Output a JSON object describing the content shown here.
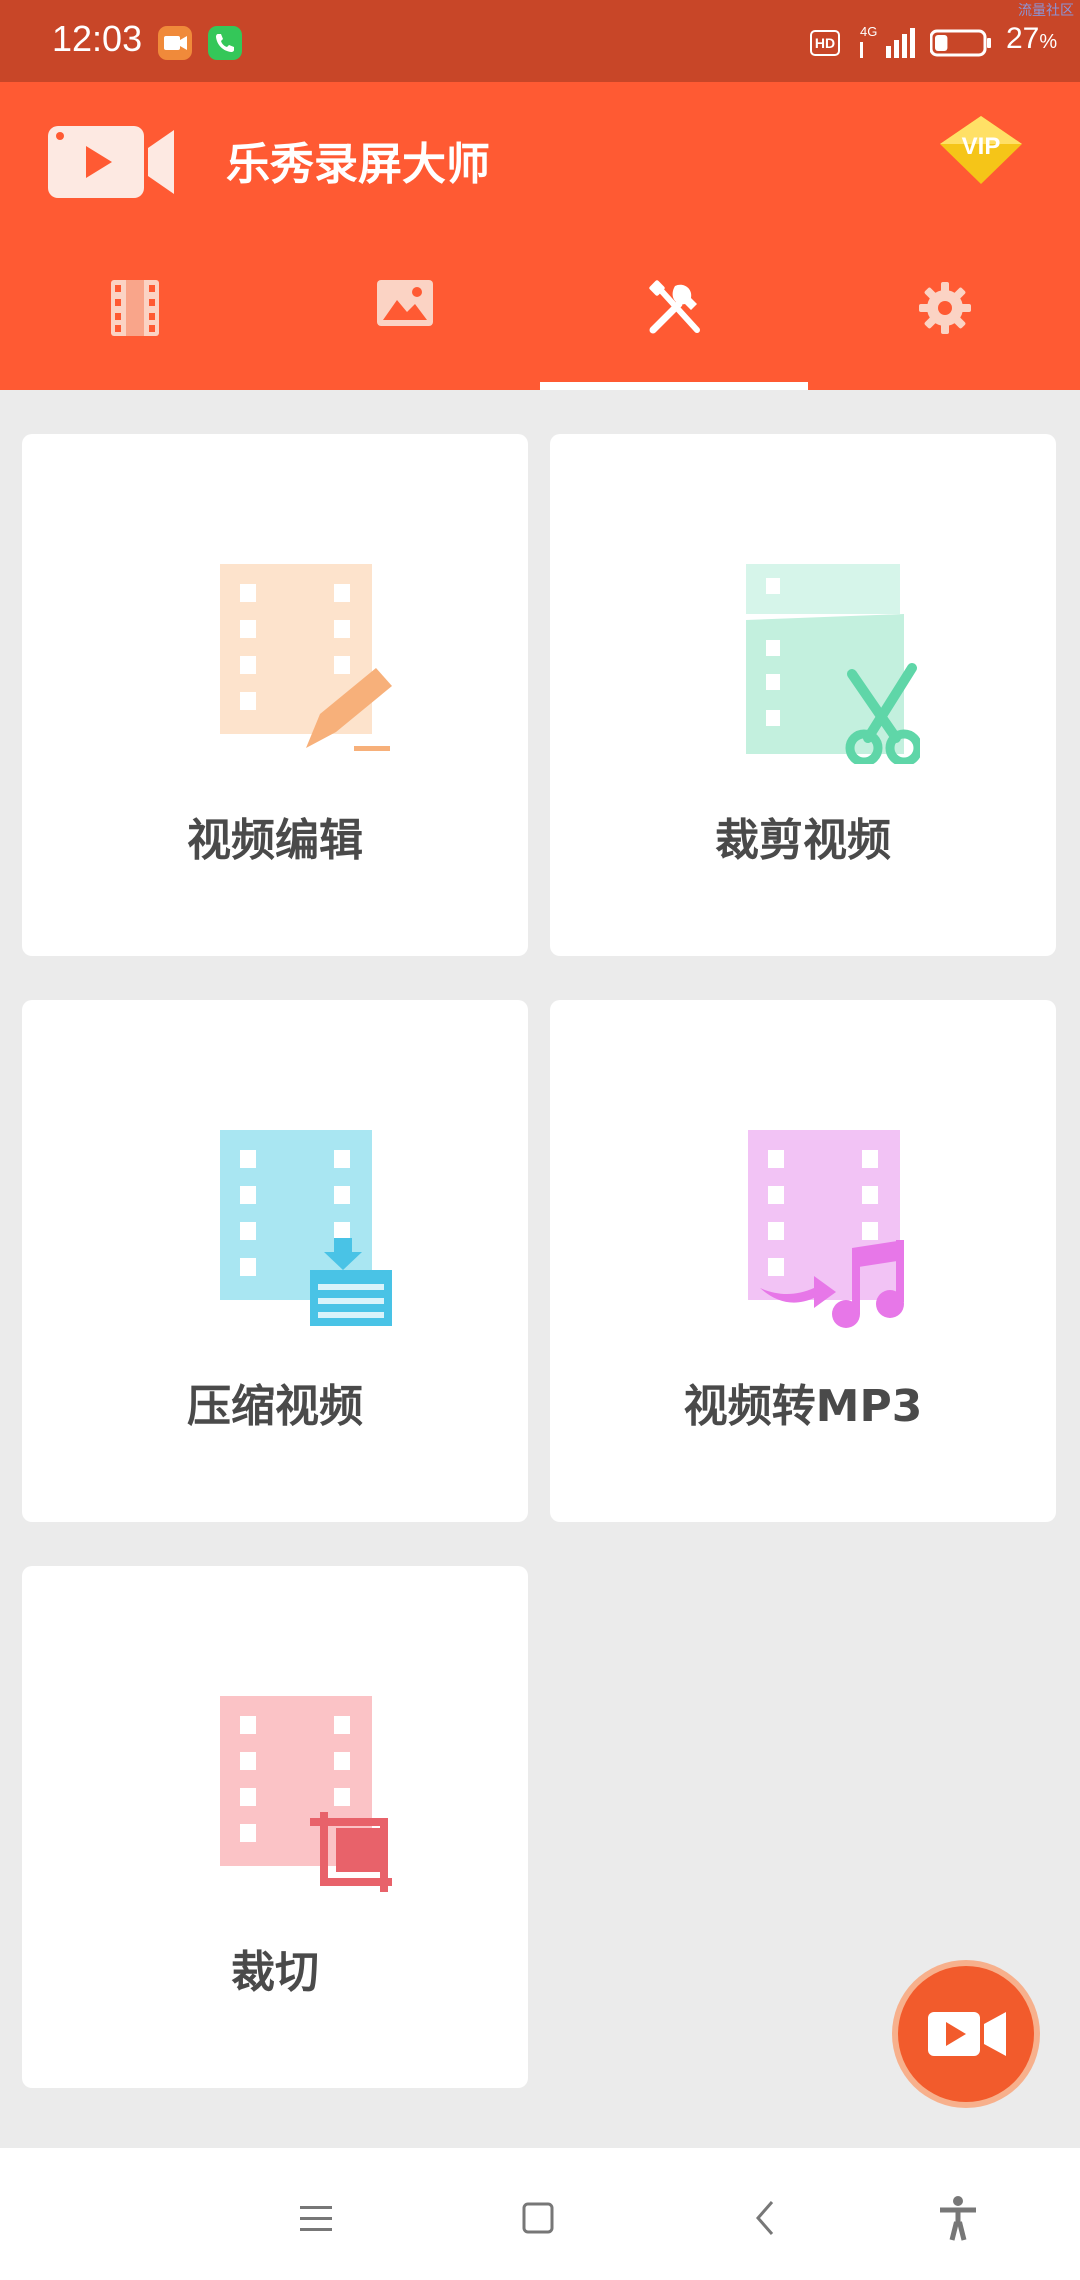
{
  "status": {
    "time": "12:03",
    "hd": "HD",
    "network": "4G",
    "battery_level": 0.27,
    "battery_pct": "27",
    "battery_unit": "%",
    "watermark": "流量社区"
  },
  "header": {
    "title": "乐秀录屏大师",
    "vip_label": "VIP"
  },
  "tabs": [
    {
      "icon": "film-icon",
      "selected": false
    },
    {
      "icon": "image-icon",
      "selected": false
    },
    {
      "icon": "tools-icon",
      "selected": true
    },
    {
      "icon": "gear-icon",
      "selected": false
    }
  ],
  "cards": [
    {
      "label": "视频编辑",
      "icon": "video-edit-icon",
      "color": "#f7b07a"
    },
    {
      "label": "裁剪视频",
      "icon": "video-trim-icon",
      "color": "#5fd6a8"
    },
    {
      "label": "压缩视频",
      "icon": "video-compress-icon",
      "color": "#49c3e6"
    },
    {
      "label": "视频转MP3",
      "icon": "video-to-mp3-icon",
      "color": "#e777e8"
    },
    {
      "label": "裁切",
      "icon": "video-crop-icon",
      "color": "#e8626a"
    }
  ],
  "colors": {
    "status_bar": "#c84628",
    "header": "#ff5a33",
    "background": "#ebebeb",
    "fab": "#f25b2c"
  },
  "nav": [
    "menu-icon",
    "home-icon",
    "back-icon",
    "accessibility-icon"
  ]
}
